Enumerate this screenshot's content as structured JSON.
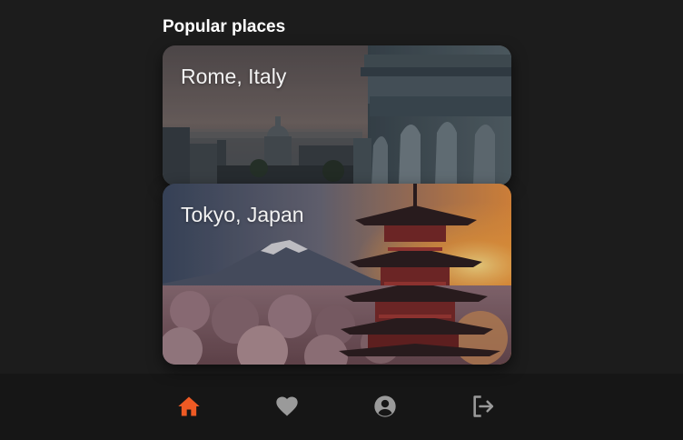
{
  "section": {
    "title": "Popular places"
  },
  "places": [
    {
      "label": "Rome, Italy"
    },
    {
      "label": "Tokyo, Japan"
    }
  ],
  "nav": {
    "items": [
      {
        "icon": "home-icon",
        "active": true
      },
      {
        "icon": "heart-icon",
        "active": false
      },
      {
        "icon": "account-icon",
        "active": false
      },
      {
        "icon": "logout-icon",
        "active": false
      }
    ],
    "active_color": "#ee5a24",
    "inactive_color": "#9a9a9a"
  },
  "colors": {
    "background": "#1c1c1c",
    "nav_background": "#161616"
  }
}
